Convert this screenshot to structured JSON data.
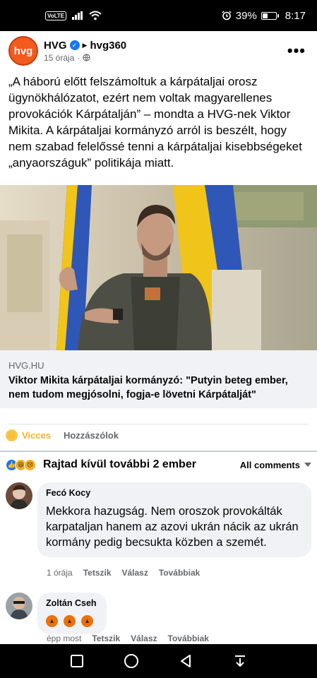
{
  "status_bar": {
    "network": "VoLTE",
    "battery_percent": "39%",
    "battery_level": 0.39,
    "time": "8:17"
  },
  "post": {
    "page_name": "HVG",
    "page_logo_text": "hvg",
    "target": "hvg360",
    "timestamp": "15 órája",
    "text": "„A háború előtt felszámoltuk a kárpátaljai orosz ügynökhálózatot, ezért nem voltak magyarellenes provokációk Kárpátalján” – mondta a HVG-nek Viktor Mikita. A kárpátaljai kormányzó arról is beszélt, hogy nem szabad felelőssé tenni a kárpátaljai kisebbségeket „anyaországuk” politikája miatt."
  },
  "link": {
    "domain": "HVG.HU",
    "title": "Viktor Mikita kárpátaljai kormányzó: \"Putyin beteg ember, nem tudom megjósolni, fogja-e lövetni Kárpátalját\""
  },
  "actions": {
    "reaction_label": "Vicces",
    "comment_label": "Hozzászólok"
  },
  "summary": {
    "text": "Rajtad kívül további 2 ember",
    "filter_label": "All comments"
  },
  "comments": [
    {
      "author": "Fecó Kocy",
      "text": "Mekkora hazugság. Nem oroszok provokálták karpataljan hanem az azovi ukrán nácik az ukrán kormány pedig becsukta közben a szemét.",
      "time": "1 órája",
      "like": "Tetszik",
      "reply": "Válasz",
      "more": "Továbbiak"
    },
    {
      "author": "Zoltán Cseh",
      "text": "",
      "time": "épp most",
      "like": "Tetszik",
      "reply": "Válasz",
      "more": "Továbbiak"
    }
  ],
  "colors": {
    "accent": "#1877f2",
    "haha": "#f7b125",
    "bubble": "#f0f2f5",
    "hvg_orange": "#f25a1e"
  }
}
